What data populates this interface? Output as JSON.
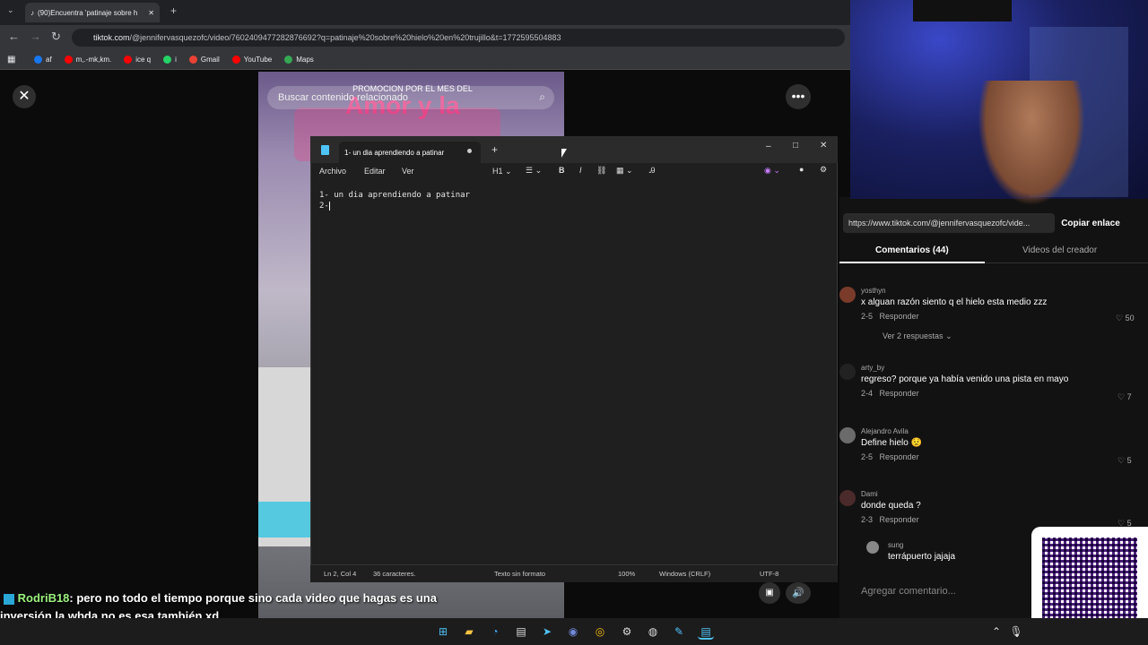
{
  "browser": {
    "tab_title": "(90)Encuentra 'patinaje sobre h",
    "url_domain": "tiktok.com",
    "url_path": "/@jennifervasquezofc/video/7602409477282876692?q=patinaje%20sobre%20hielo%20en%20trujillo&t=1772595504883",
    "bookmarks": [
      "af",
      "m,.-mk,km.",
      "ice q",
      "i",
      "Gmail",
      "YouTube",
      "Maps"
    ]
  },
  "tiktok": {
    "search_placeholder": "Buscar contenido relacionado",
    "video_banner_small": "PROMOCION POR EL MES DEL",
    "video_banner_big": "Amor y la",
    "share_link": "https://www.tiktok.com/@jennifervasquezofc/vide...",
    "copy_label": "Copiar enlace",
    "tab_comments": "Comentarios (44)",
    "tab_creator": "Videos del creador",
    "comments": [
      {
        "user": "yosthyn",
        "text": "x alguan razón siento q el hielo esta medio zzz",
        "date": "2-5",
        "reply": "Responder",
        "likes": "50",
        "more": "Ver 2 respuestas"
      },
      {
        "user": "arty_by",
        "text": "regreso? porque ya había venido una pista en mayo",
        "date": "2-4",
        "reply": "Responder",
        "likes": "7"
      },
      {
        "user": "Alejandro Avila",
        "text": "Define hielo 😟",
        "date": "2-5",
        "reply": "Responder",
        "likes": "5"
      },
      {
        "user": "Dami",
        "text": "donde queda ?",
        "date": "2-3",
        "reply": "Responder",
        "likes": "5"
      },
      {
        "user": "sung",
        "text": "terrápuerto jajaja"
      }
    ],
    "add_comment_placeholder": "Agregar comentario..."
  },
  "notepad": {
    "tab_title": "1- un dia aprendiendo a patinar",
    "menu": [
      "Archivo",
      "Editar",
      "Ver"
    ],
    "heading_label": "H1",
    "lines": [
      "1- un dia aprendiendo a patinar",
      "2- "
    ],
    "status": {
      "position": "Ln 2, Col 4",
      "chars": "36 caracteres.",
      "format": "Texto sin formato",
      "zoom": "100%",
      "eol": "Windows (CRLF)",
      "encoding": "UTF-8"
    }
  },
  "chat": {
    "username": "RodriB18",
    "message": ": pero no todo el tiempo porque sino cada video que hagas es una inversión la wbda no es esa también xd"
  },
  "colors": {
    "accent_pink": "#e7478a",
    "chat_name": "#9bf27e"
  }
}
